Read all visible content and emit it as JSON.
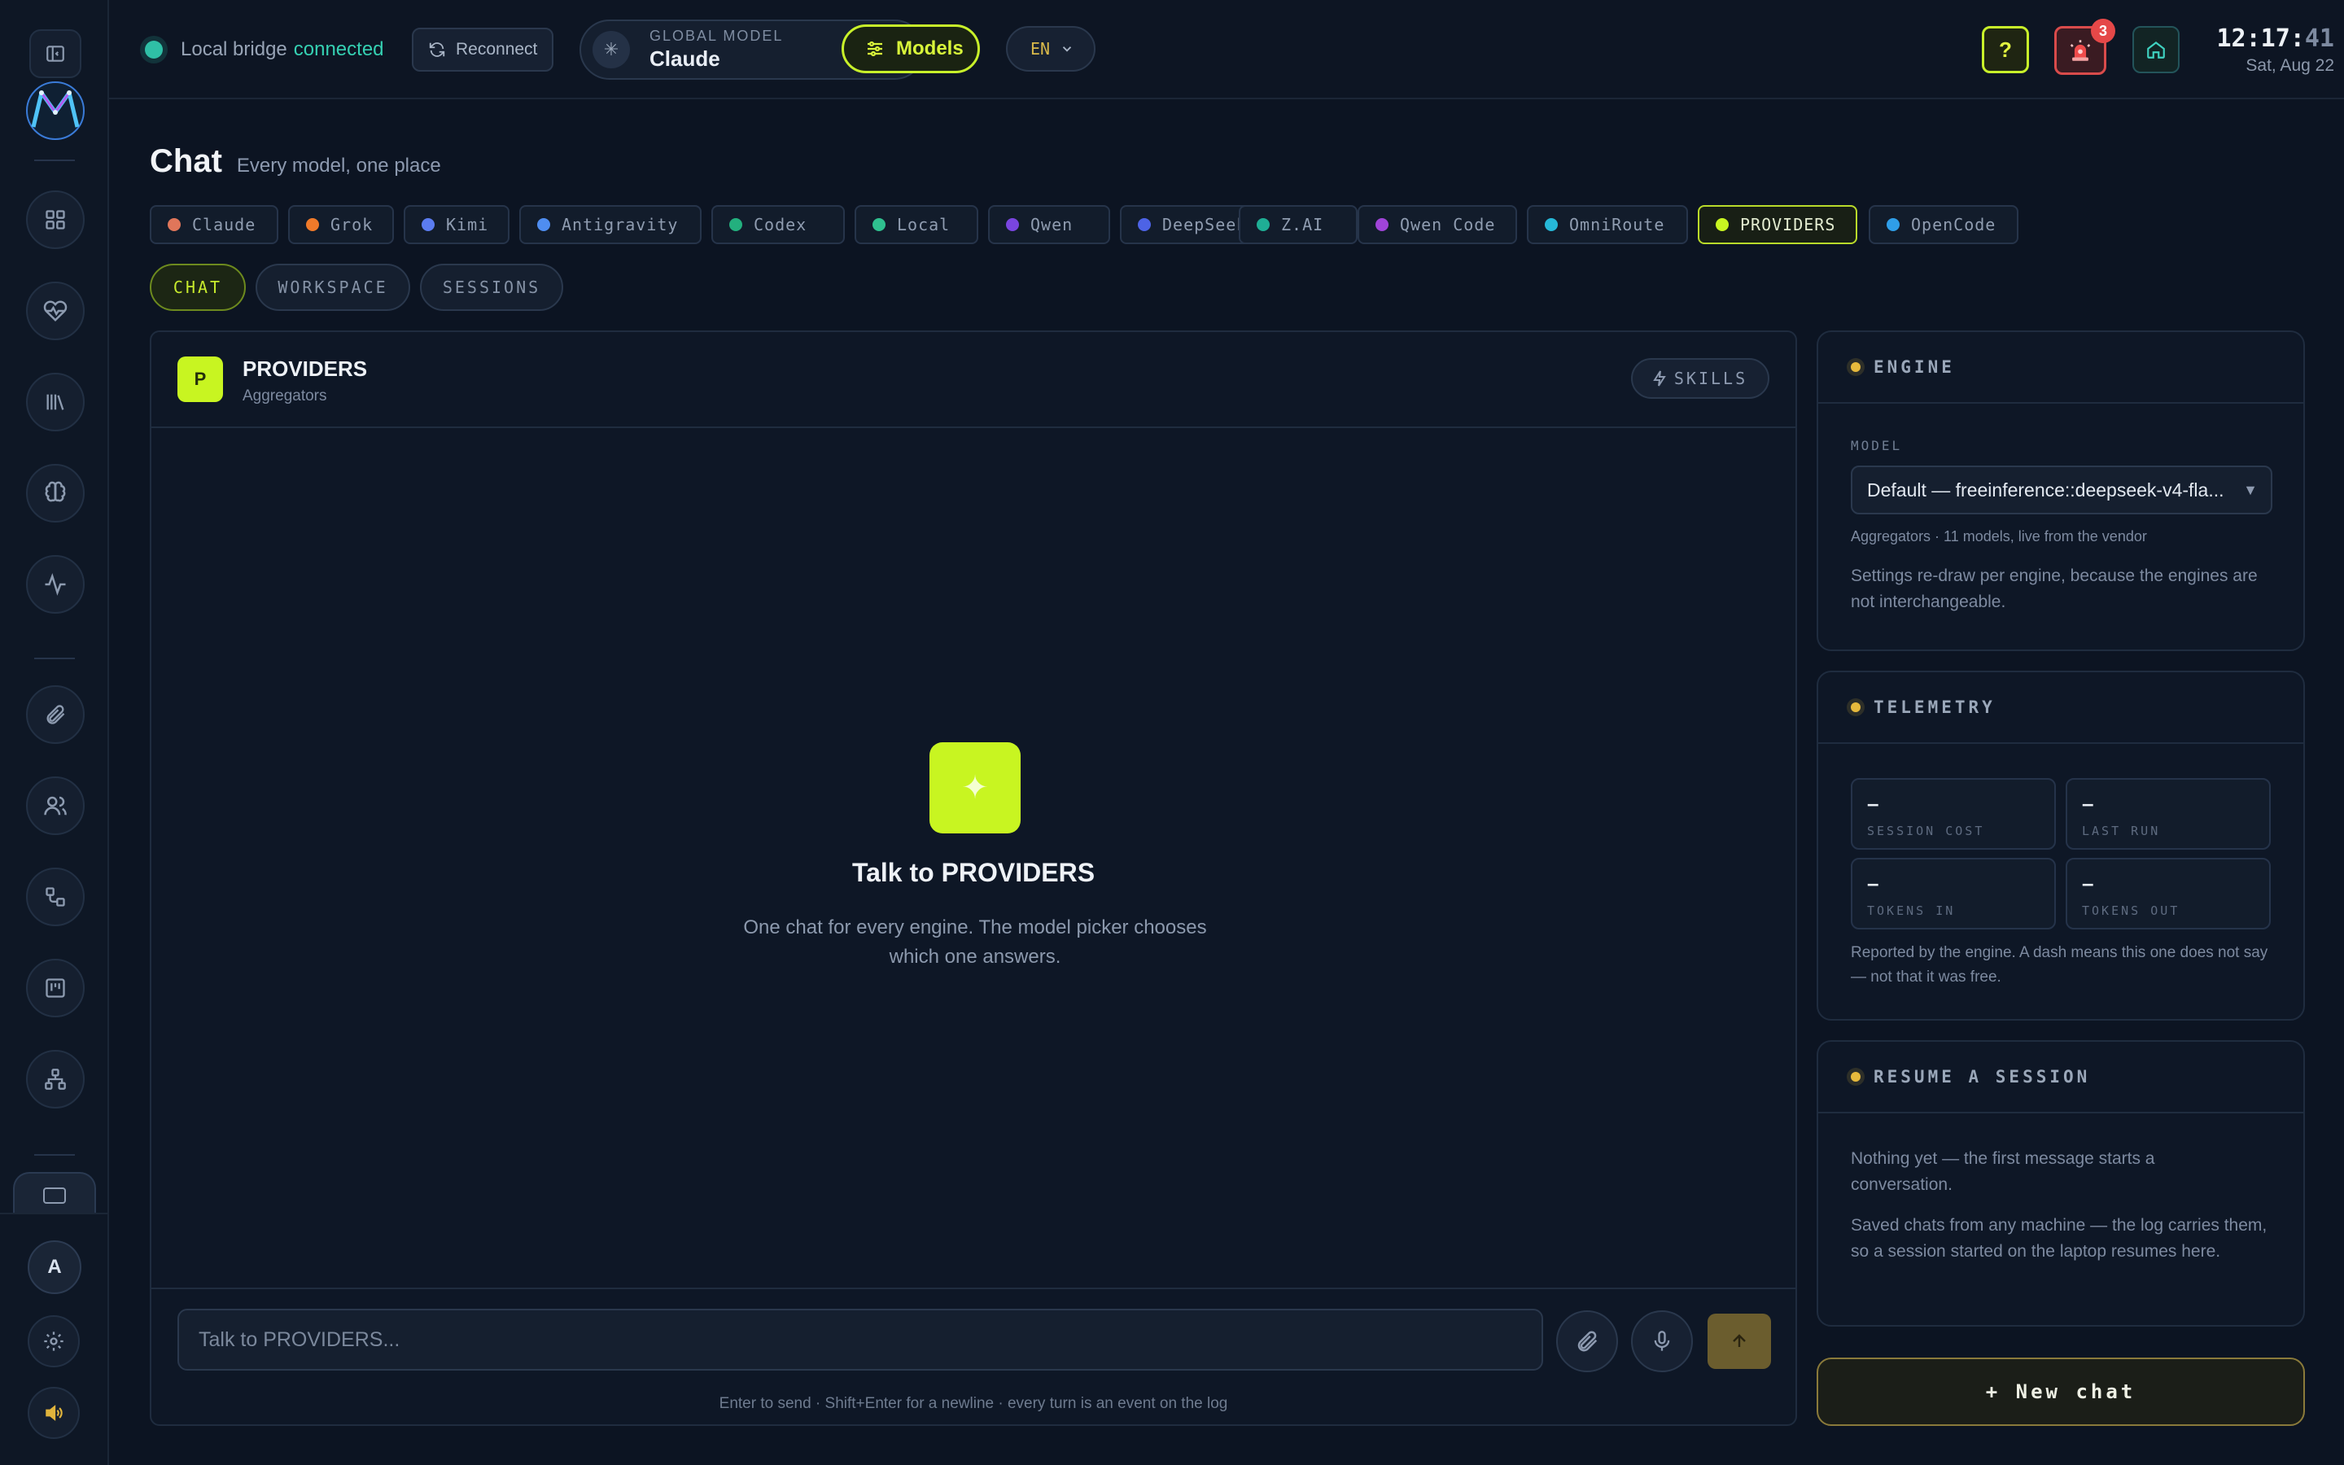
{
  "topbar": {
    "bridge_label": "Local bridge",
    "bridge_status": "connected",
    "reconnect_label": "Reconnect",
    "global_model_label": "GLOBAL MODEL",
    "global_model_value": "Claude",
    "models_label": "Models",
    "language": "EN",
    "help_label": "?",
    "alert_count": "3",
    "clock_hm": "12:17:",
    "clock_s": "41",
    "date": "Sat, Aug 22"
  },
  "page": {
    "title": "Chat",
    "subtitle": "Every model, one place"
  },
  "engines": [
    {
      "label": "Claude",
      "color": "#e0765a"
    },
    {
      "label": "Grok",
      "color": "#f07a2a"
    },
    {
      "label": "Kimi",
      "color": "#5b7cf0"
    },
    {
      "label": "Antigravity",
      "color": "#4f8df0"
    },
    {
      "label": "Codex",
      "color": "#23b07e"
    },
    {
      "label": "Local",
      "color": "#2fc08f"
    },
    {
      "label": "Qwen",
      "color": "#7a45e0"
    },
    {
      "label": "DeepSeek",
      "color": "#4d63e6"
    },
    {
      "label": "Z.AI",
      "color": "#1fae95"
    },
    {
      "label": "Qwen Code",
      "color": "#a044d8"
    },
    {
      "label": "OmniRoute",
      "color": "#26b8d8"
    },
    {
      "label": "PROVIDERS",
      "color": "#c8f521"
    },
    {
      "label": "OpenCode",
      "color": "#2f9ee8"
    }
  ],
  "tabs": [
    "CHAT",
    "WORKSPACE",
    "SESSIONS"
  ],
  "chat": {
    "provider_initial": "P",
    "provider_name": "PROVIDERS",
    "provider_sub": "Aggregators",
    "skills_label": "SKILLS",
    "empty_icon": "sparkle-icon",
    "empty_title": "Talk to PROVIDERS",
    "empty_text": "One chat for every engine. The model picker chooses which one answers.",
    "input_placeholder": "Talk to PROVIDERS...",
    "hint": "Enter to send · Shift+Enter for a newline · every turn is an event on the log"
  },
  "engine_card": {
    "title": "ENGINE",
    "model_label": "MODEL",
    "model_value": "Default — freeinference::deepseek-v4-fla...",
    "model_meta": "Aggregators · 11 models, live from the vendor",
    "note": "Settings re-draw per engine, because the engines are not interchangeable."
  },
  "telemetry": {
    "title": "TELEMETRY",
    "session_cost": "–",
    "session_cost_label": "SESSION COST",
    "last_run": "–",
    "last_run_label": "LAST RUN",
    "tokens_in": "–",
    "tokens_in_label": "TOKENS IN",
    "tokens_out": "–",
    "tokens_out_label": "TOKENS OUT",
    "note": "Reported by the engine. A dash means this one does not say — not that it was free."
  },
  "resume": {
    "title": "RESUME A SESSION",
    "empty": "Nothing yet — the first message starts a conversation.",
    "note": "Saved chats from any machine — the log carries them, so a session started on the laptop resumes here."
  },
  "new_chat_label": "+ New chat",
  "sidebar": {
    "avatar_initial": "A",
    "icons": [
      "panel-toggle-icon",
      "grid-icon",
      "heart-pulse-icon",
      "library-icon",
      "brain-icon",
      "activity-icon",
      "paperclip-icon",
      "users-icon",
      "workflow-icon",
      "kanban-icon",
      "network-icon",
      "chat-icon",
      "settings-icon",
      "volume-icon"
    ]
  }
}
